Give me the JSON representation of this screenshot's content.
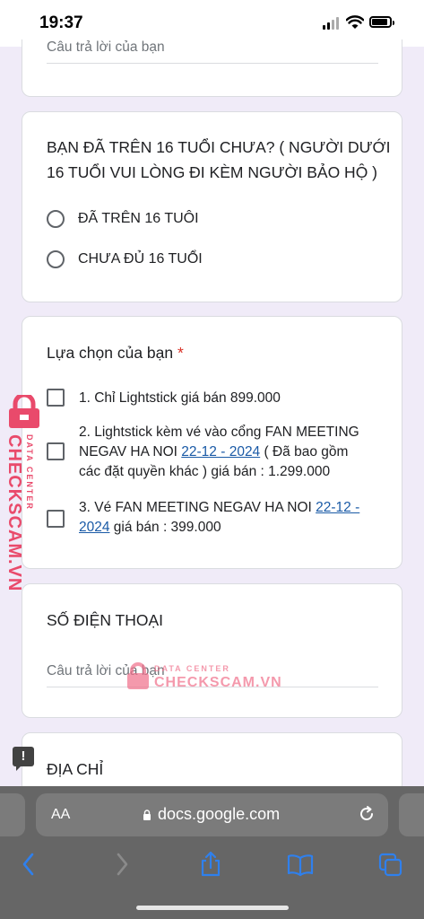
{
  "status_bar": {
    "time": "19:37"
  },
  "form": {
    "top_card": {
      "answer_placeholder": "Câu trả lời của bạn"
    },
    "age_question": {
      "title_line1": "BẠN ĐÃ TRÊN 16 TUỔI CHƯA? ( NGƯỜI DƯỚI",
      "title_line2": "16 TUỔI VUI LÒNG ĐI KÈM NGƯỜI BẢO HỘ )",
      "options": [
        "ĐÃ TRÊN 16 TUÔI",
        "CHƯA ĐỦ 16 TUỔI"
      ]
    },
    "choice_question": {
      "title": "Lựa chọn của bạn",
      "required_mark": "*",
      "options": [
        {
          "line1": "1. Chỉ Lightstick giá bán 899.000"
        },
        {
          "line1": "2. Lightstick kèm vé vào cổng FAN MEETING",
          "line2_pre": "NEGAV HA NOI ",
          "line2_link": "22-12 - 2024",
          "line2_post": " ( Đã bao gồm",
          "line3": "các đặt quyền khác ) giá bán : 1.299.000"
        },
        {
          "line1_pre": "3. Vé FAN MEETING NEGAV HA NOI ",
          "line1_link": "22-12 -",
          "line2_link": "2024",
          "line2_post": " giá bán : 399.000"
        }
      ]
    },
    "phone_question": {
      "title": "SỐ ĐIỆN THOẠI",
      "answer_placeholder": "Câu trả lời của bạn"
    },
    "address_question": {
      "title": "ĐỊA CHỈ"
    },
    "report_icon_text": "!"
  },
  "browser": {
    "text_size_label": "AA",
    "url": "docs.google.com"
  },
  "watermark": {
    "side_text": "CHECKSCAM.VN",
    "side_subtext": "DATA CENTER",
    "center_top": "DATA CENTER",
    "center_main": "CHECKSCAM.VN"
  },
  "colors": {
    "background": "#f0ebf8",
    "required": "#d93025",
    "link": "#1a5aa6",
    "watermark": "#e94a6b"
  }
}
